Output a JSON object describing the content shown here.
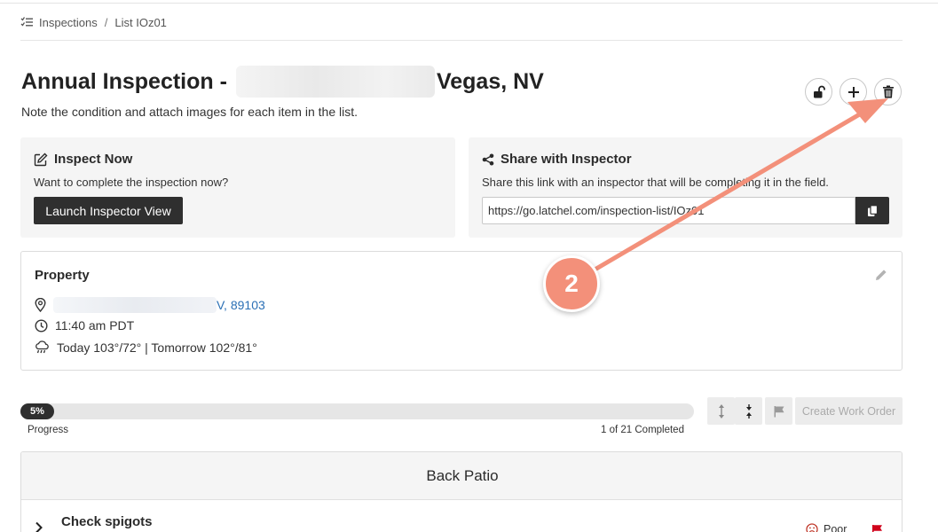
{
  "breadcrumb": {
    "root": "Inspections",
    "separator": "/",
    "current": "List IOz01"
  },
  "header": {
    "title_prefix": "Annual Inspection -",
    "title_suffix": "Vegas, NV",
    "subtitle": "Note the condition and attach images for each item in the list."
  },
  "actions": {
    "lock_icon": "unlock-icon",
    "add_icon": "plus-icon",
    "delete_icon": "trash-icon"
  },
  "inspect_now": {
    "title": "Inspect Now",
    "text": "Want to complete the inspection now?",
    "button": "Launch Inspector View"
  },
  "share": {
    "title": "Share with Inspector",
    "text": "Share this link with an inspector that will be completing it in the field.",
    "link": "https://go.latchel.com/inspection-list/IOz01"
  },
  "property": {
    "title": "Property",
    "address_suffix": "V, 89103",
    "time": "11:40 am PDT",
    "weather": "Today 103°/72° | Tomorrow 102°/81°"
  },
  "progress": {
    "percent_label": "5%",
    "fraction": 0.05,
    "label": "Progress",
    "count": "1 of 21 Completed"
  },
  "toolbar": {
    "work_order": "Create Work Order"
  },
  "section": {
    "title": "Back Patio",
    "items": [
      {
        "label": "Check spigots",
        "status": "Poor"
      }
    ]
  },
  "annotation": {
    "step": "2"
  },
  "colors": {
    "dark": "#2f2f2f",
    "link": "#2a6fb5",
    "badge": "#f3907a",
    "flag": "#d0021b"
  }
}
